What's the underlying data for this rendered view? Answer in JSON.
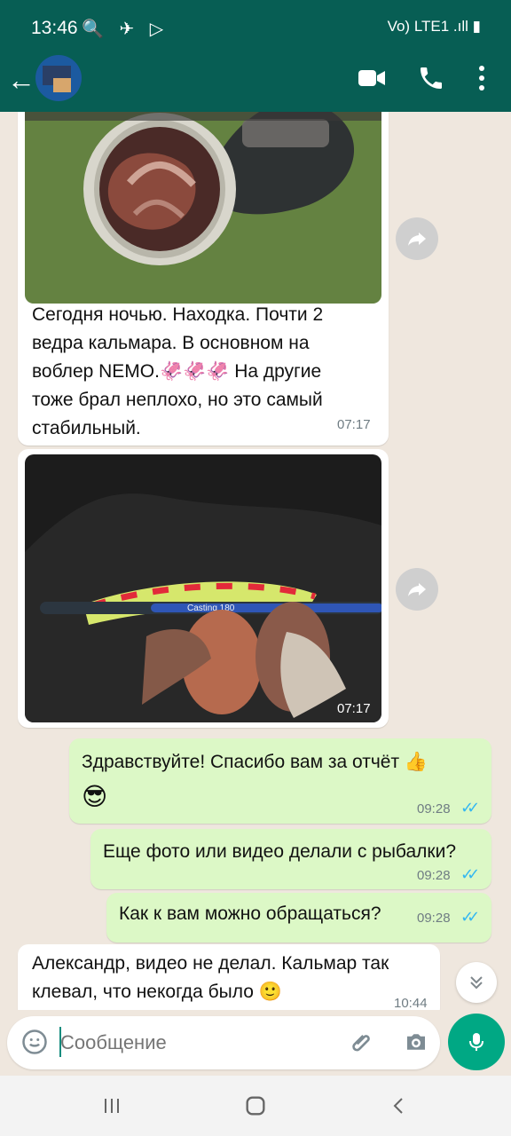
{
  "status": {
    "time": "13:46",
    "notify_icons": [
      "search-icon",
      "telegram-icon",
      "play-icon"
    ],
    "right": "Vo) LTE1 .ıll ▮"
  },
  "header": {
    "back": "←",
    "contact": ""
  },
  "messages": [
    {
      "side": "in",
      "type": "image_caption",
      "caption": "Сегодня ночью. Находка. Почти 2 ведра  кальмара. В основном на воблер NEMO.🦑🦑🦑 На другие тоже брал неплохо, но это самый стабильный.",
      "time": "07:17"
    },
    {
      "side": "in",
      "type": "image",
      "time": "07:17",
      "lure_text": "Casting 180"
    },
    {
      "side": "out",
      "text": "Здравствуйте! Спасибо вам за отчёт 👍",
      "extra": "😎",
      "time": "09:28"
    },
    {
      "side": "out",
      "text": "Еще фото или видео делали с рыбалки?",
      "time": "09:28"
    },
    {
      "side": "out",
      "text": "Как к вам можно обращаться?",
      "time": "09:28"
    },
    {
      "side": "in",
      "text": "Александр, видео не делал. Кальмар так клевал, что некогда было 🙂",
      "time": "10:44"
    }
  ],
  "composer": {
    "placeholder": "Сообщение"
  },
  "colors": {
    "header": "#075e54",
    "out_bubble": "#dcf8c6",
    "accent": "#00a884"
  }
}
